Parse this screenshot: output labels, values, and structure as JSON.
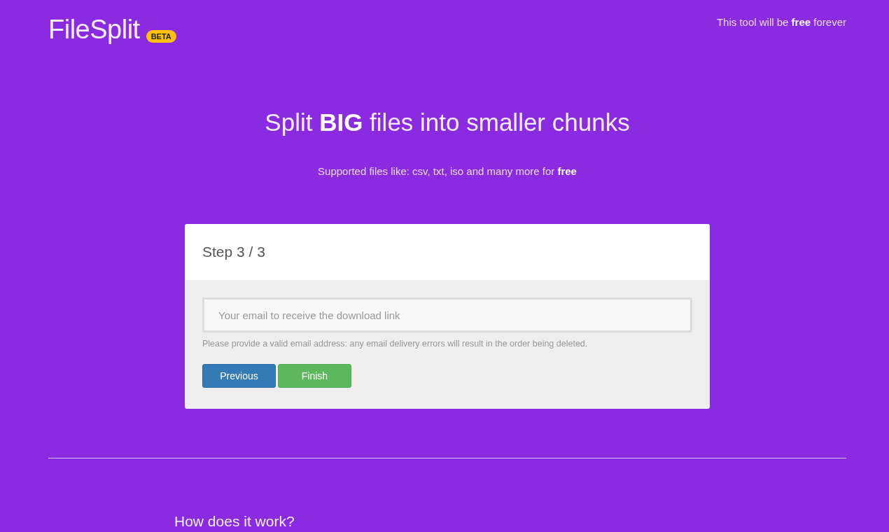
{
  "header": {
    "logo": "FileSplit",
    "badge": "BETA",
    "tagline": "This tool will be **free** forever"
  },
  "hero": {
    "title": "Split **BIG** files into smaller chunks",
    "subtitle": "Supported files like: csv, txt, iso and many more for **free**"
  },
  "card": {
    "title": "Step 3 / 3",
    "email_field": {
      "placeholder": "Your email to receive the download link"
    },
    "help_text": "Please provide a valid email address: any email delivery errors will result in the order being deleted.",
    "buttons": [
      {
        "label": "Previous",
        "kind": "back"
      },
      {
        "label": "Finish",
        "kind": "submit"
      }
    ]
  },
  "section": {
    "title": "How does it work?"
  }
}
